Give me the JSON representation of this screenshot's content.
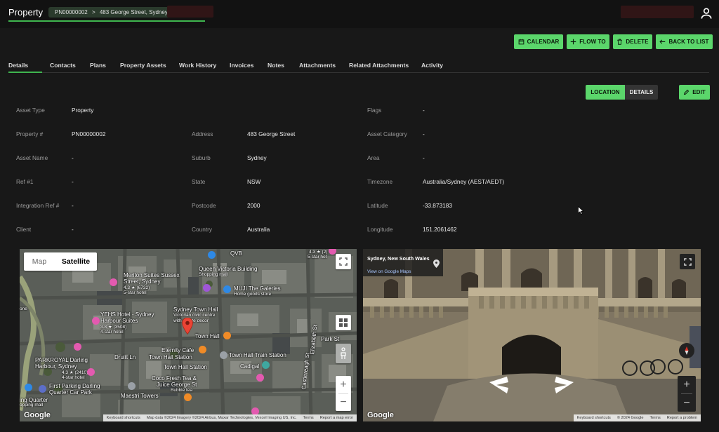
{
  "header": {
    "title": "Property",
    "breadcrumb_id": "PN00000002",
    "breadcrumb_sep": ">",
    "breadcrumb_address": "483 George Street, Sydney"
  },
  "actions": {
    "calendar": "CALENDAR",
    "flow_to": "FLOW TO",
    "delete": "DELETE",
    "back": "BACK TO LIST"
  },
  "tabs": [
    "Details",
    "Contacts",
    "Plans",
    "Property Assets",
    "Work History",
    "Invoices",
    "Notes",
    "Attachments",
    "Related Attachments",
    "Activity"
  ],
  "view_toggle": {
    "location": "LOCATION",
    "details": "DETAILS"
  },
  "edit_label": "EDIT",
  "fields": {
    "col1": [
      {
        "label": "Asset Type",
        "value": "Property"
      },
      {
        "label": "Property #",
        "value": "PN00000002"
      },
      {
        "label": "Asset Name",
        "value": "-"
      },
      {
        "label": "Ref #1",
        "value": "-"
      },
      {
        "label": "Integration Ref #",
        "value": "-"
      },
      {
        "label": "Client",
        "value": "-"
      }
    ],
    "col2": [
      {
        "label": "Address",
        "value": "483 George Street"
      },
      {
        "label": "Suburb",
        "value": "Sydney"
      },
      {
        "label": "State",
        "value": "NSW"
      },
      {
        "label": "Postcode",
        "value": "2000"
      },
      {
        "label": "Country",
        "value": "Australia"
      }
    ],
    "col3": [
      {
        "label": "Flags",
        "value": "-"
      },
      {
        "label": "Asset Category",
        "value": "-"
      },
      {
        "label": "Area",
        "value": "-"
      },
      {
        "label": "Timezone",
        "value": "Australia/Sydney (AEST/AEDT)"
      },
      {
        "label": "Latitude",
        "value": "-33.873183"
      },
      {
        "label": "Longitude",
        "value": "151.2061462"
      }
    ]
  },
  "map": {
    "map_label": "Map",
    "satellite_label": "Satellite",
    "zoom_in": "+",
    "zoom_out": "−",
    "google": "Google",
    "attribution": {
      "shortcuts": "Keyboard shortcuts",
      "data": "Map data ©2024 Imagery ©2024 Airbus, Maxar Technologies, Vexcel Imaging US, Inc.",
      "terms": "Terms",
      "report": "Report a map error"
    },
    "pois": {
      "qvb": "QVB",
      "meriton": "Meriton Suites Sussex",
      "meriton2": "Street, Sydney",
      "meriton_rating": "4.3 ★ (6732)",
      "meriton_type": "5-star hotel",
      "qvb_building": "Queen Victoria Building",
      "qvb_type": "Shopping mall",
      "muji": "MUJI The Galeries",
      "muji_type": "Home goods store",
      "town_hall": "Sydney Town Hall",
      "town_hall_type": "Victorian civic centre",
      "town_hall_type2": "with ornate decor",
      "yehs": "YEHS Hotel - Sydney",
      "yehs2": "Harbour Suites",
      "yehs_rating": "3.8 ★ (3508)",
      "yehs_type": "4-star hotel",
      "town_hall_station": "Town Hall",
      "eternity": "Eternity Cafe",
      "th_station": "Town Hall Station",
      "th_station2": "Town Hall Station",
      "th_station3": "Town Hall Train Station",
      "park_st": "Park St",
      "druitt": "Druitt Ln",
      "parkroyal": "PARKROYAL Darling",
      "parkroyal2": "Harbour, Sydney",
      "parkroyal_rating": "4.3 ★ (2410)",
      "parkroyal_type": "4-star hotel",
      "first_parking": "First Parking Darling",
      "first_parking2": "Quarter Car Park",
      "darling_q": "ing Quarter",
      "darling_q2": "opping mall",
      "coco": "Coco Fresh Tea &",
      "coco2": "Juice George St",
      "coco_type": "Bubble tea",
      "maestri": "Maestri Towers",
      "cadigal": "Cadigal",
      "castlereagh": "Castlereagh St",
      "elizabeth": "Elizabeth St",
      "rating_top": "4.3 ★ (2)",
      "star_top": "5-star hot",
      "one": "one"
    }
  },
  "streetview": {
    "title": "Sydney, New South Wales",
    "link": "View on Google Maps",
    "zoom_in": "+",
    "zoom_out": "−",
    "google": "Google",
    "attribution": {
      "shortcuts": "Keyboard shortcuts",
      "data": "© 2024 Google",
      "terms": "Terms",
      "report": "Report a problem"
    }
  },
  "colors": {
    "accent": "#5bd66b",
    "underline": "#3fb64f",
    "background": "#181818",
    "topbar": "#121212"
  }
}
